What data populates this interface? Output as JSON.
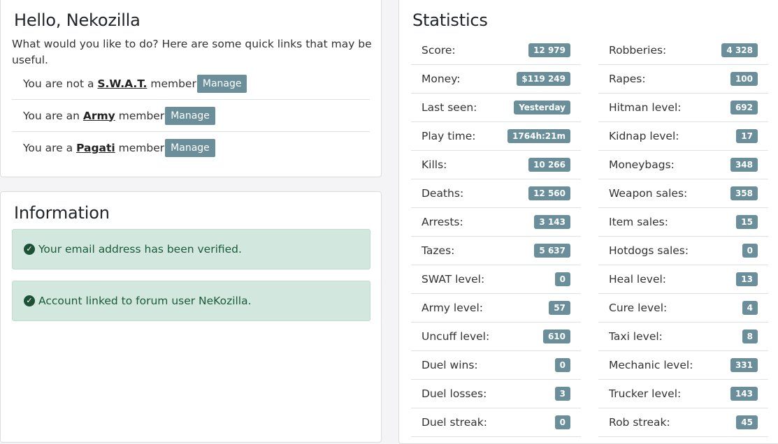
{
  "welcome": {
    "title": "Hello, Nekozilla",
    "intro": "What would you like to do? Here are some quick links that may be useful.",
    "memberships": [
      {
        "pre": "You are not a ",
        "group": "S.W.A.T.",
        "post": " member",
        "button": "Manage"
      },
      {
        "pre": "You are an ",
        "group": "Army",
        "post": " member",
        "button": "Manage"
      },
      {
        "pre": "You are a ",
        "group": "Pagati",
        "post": " member",
        "button": "Manage"
      }
    ]
  },
  "information": {
    "title": "Information",
    "alerts": [
      "Your email address has been verified.",
      "Account linked to forum user NeKozilla."
    ]
  },
  "statistics": {
    "title": "Statistics",
    "left": [
      {
        "label": "Score:",
        "value": "12 979"
      },
      {
        "label": "Money:",
        "value": "$119 249"
      },
      {
        "label": "Last seen:",
        "value": "Yesterday"
      },
      {
        "label": "Play time:",
        "value": "1764h:21m"
      },
      {
        "label": "Kills:",
        "value": "10 266"
      },
      {
        "label": "Deaths:",
        "value": "12 560"
      },
      {
        "label": "Arrests:",
        "value": "3 143"
      },
      {
        "label": "Tazes:",
        "value": "5 637"
      },
      {
        "label": "SWAT level:",
        "value": "0"
      },
      {
        "label": "Army level:",
        "value": "57"
      },
      {
        "label": "Uncuff level:",
        "value": "610"
      },
      {
        "label": "Duel wins:",
        "value": "0"
      },
      {
        "label": "Duel losses:",
        "value": "3"
      },
      {
        "label": "Duel streak:",
        "value": "0"
      }
    ],
    "right": [
      {
        "label": "Robberies:",
        "value": "4 328"
      },
      {
        "label": "Rapes:",
        "value": "100"
      },
      {
        "label": "Hitman level:",
        "value": "692"
      },
      {
        "label": "Kidnap level:",
        "value": "17"
      },
      {
        "label": "Moneybags:",
        "value": "348"
      },
      {
        "label": "Weapon sales:",
        "value": "358"
      },
      {
        "label": "Item sales:",
        "value": "15"
      },
      {
        "label": "Hotdogs sales:",
        "value": "0"
      },
      {
        "label": "Heal level:",
        "value": "13"
      },
      {
        "label": "Cure level:",
        "value": "4"
      },
      {
        "label": "Taxi level:",
        "value": "8"
      },
      {
        "label": "Mechanic level:",
        "value": "331"
      },
      {
        "label": "Trucker level:",
        "value": "143"
      },
      {
        "label": "Rob streak:",
        "value": "45"
      }
    ]
  }
}
